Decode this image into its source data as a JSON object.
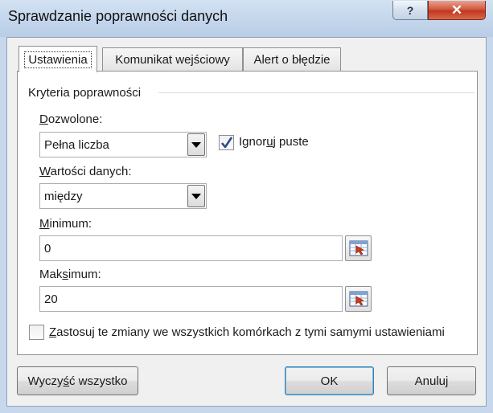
{
  "dialog": {
    "title": "Sprawdzanie poprawności danych",
    "help_label": "?",
    "close_label": "✕"
  },
  "tabs": [
    {
      "label": "Ustawienia",
      "active": true
    },
    {
      "label": "Komunikat wejściowy",
      "active": false
    },
    {
      "label": "Alert o błędzie",
      "active": false
    }
  ],
  "criteria": {
    "group_label": "Kryteria poprawności",
    "allow_label_pre": "",
    "allow_label_key": "D",
    "allow_label_post": "ozwolone:",
    "allow_value": "Pełna liczba",
    "ignore_blank_pre": "Ignor",
    "ignore_blank_key": "u",
    "ignore_blank_post": "j puste",
    "ignore_blank_checked": true,
    "data_label_pre": "",
    "data_label_key": "W",
    "data_label_post": "artości danych:",
    "data_value": "między",
    "min_label_pre": "",
    "min_label_key": "M",
    "min_label_post": "inimum:",
    "min_value": "0",
    "max_label_pre": "Mak",
    "max_label_key": "s",
    "max_label_post": "imum:",
    "max_value": "20",
    "apply_all_pre": "",
    "apply_all_key": "Z",
    "apply_all_post": "astosuj te zmiany we wszystkich komórkach z tymi samymi ustawieniami",
    "apply_all_checked": false
  },
  "buttons": {
    "clear_pre": "Wyczy",
    "clear_key": "ś",
    "clear_post": "ć wszystko",
    "ok": "OK",
    "cancel": "Anuluj"
  },
  "colors": {
    "accent": "#3c7fb1",
    "close_red": "#c2371e",
    "checkmark": "#2b4d8c"
  }
}
